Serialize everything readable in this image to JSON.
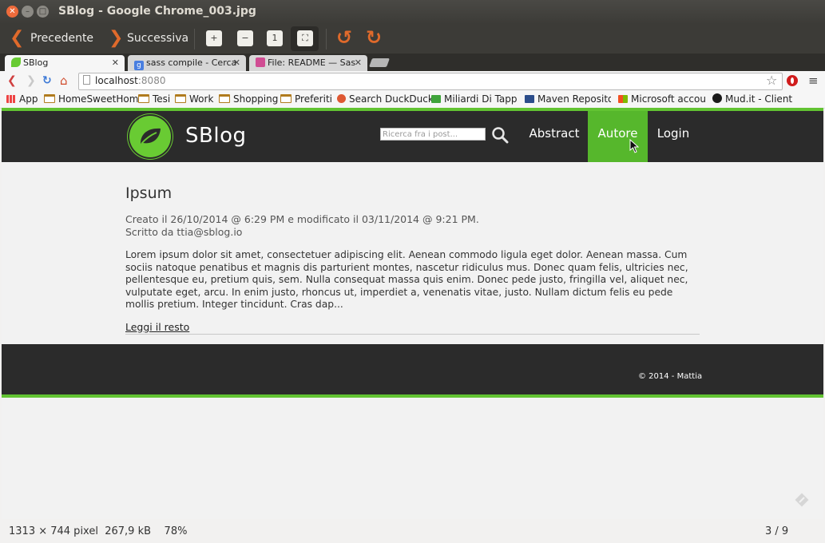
{
  "window": {
    "title": "SBlog - Google Chrome_003.jpg"
  },
  "viewer_toolbar": {
    "prev_label": "Precedente",
    "next_label": "Successiva"
  },
  "tabs": [
    {
      "label": "SBlog",
      "icon": "leaf-favicon"
    },
    {
      "label": "sass compile - Cerca",
      "icon": "google-favicon"
    },
    {
      "label": "File: README — Sas",
      "icon": "sass-favicon"
    }
  ],
  "address": {
    "host": "localhost",
    "port": ":8080"
  },
  "bookmarks": [
    {
      "label": "App",
      "icon": "apps-grid-icon"
    },
    {
      "label": "HomeSweetHom",
      "icon": "folder-icon"
    },
    {
      "label": "Tesi",
      "icon": "folder-icon"
    },
    {
      "label": "Work",
      "icon": "folder-icon"
    },
    {
      "label": "Shopping",
      "icon": "folder-icon"
    },
    {
      "label": "Preferiti",
      "icon": "folder-icon"
    },
    {
      "label": "Search DuckDuck",
      "icon": "duckduckgo-icon"
    },
    {
      "label": "Miliardi Di Tappe",
      "icon": "site-icon"
    },
    {
      "label": "Maven Repositor",
      "icon": "maven-icon"
    },
    {
      "label": "Microsoft accoun",
      "icon": "microsoft-icon"
    },
    {
      "label": "Mud.it - Client",
      "icon": "mud-icon"
    }
  ],
  "site": {
    "brand": "SBlog",
    "search_placeholder": "Ricerca fra i post...",
    "nav": {
      "abstract": "Abstract",
      "autore": "Autore",
      "login": "Login"
    },
    "accent_color": "#62c332"
  },
  "post": {
    "title": "Ipsum",
    "meta_created": "Creato il 26/10/2014 @ 6:29 PM e modificato il 03/11/2014 @ 9:21 PM.",
    "meta_author": "Scritto da ttia@sblog.io",
    "body": "Lorem ipsum dolor sit amet, consectetuer adipiscing elit. Aenean commodo ligula eget dolor. Aenean massa. Cum sociis natoque penatibus et magnis dis parturient montes, nascetur ridiculus mus. Donec quam felis, ultricies nec, pellentesque eu, pretium quis, sem. Nulla consequat massa quis enim. Donec pede justo, fringilla vel, aliquet nec, vulputate eget, arcu. In enim justo, rhoncus ut, imperdiet a, venenatis vitae, justo. Nullam dictum felis eu pede mollis pretium. Integer tincidunt. Cras dap...",
    "read_more": "Leggi il resto"
  },
  "footer": {
    "copyright": "© 2014 - Mattia"
  },
  "status": {
    "info": "1313 × 744 pixel  267,9 kB    78%",
    "page": "3 / 9"
  }
}
